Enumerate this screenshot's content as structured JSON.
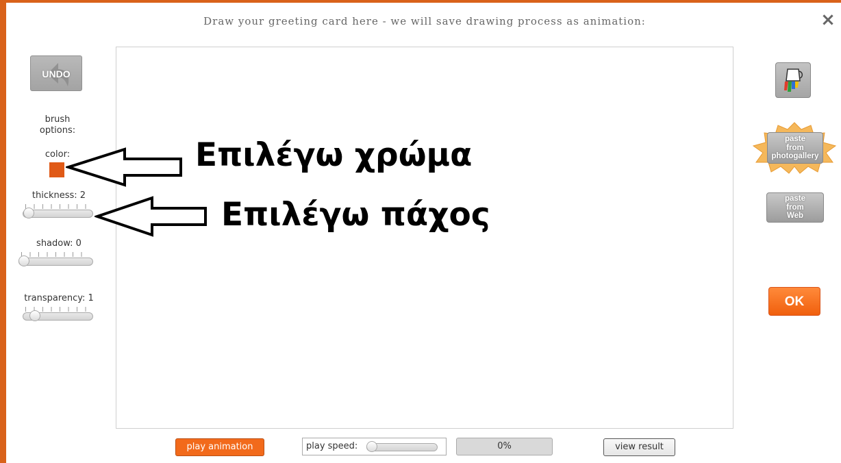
{
  "header": {
    "title": "Draw your greeting card here - we will save drawing process as animation:",
    "close_icon": "×"
  },
  "left_panel": {
    "undo_label": "UNDO",
    "brush_options_line1": "brush",
    "brush_options_line2": "options:",
    "color_label": "color:",
    "color_value": "#e05a17",
    "thickness_label": "thickness: 2",
    "shadow_label": "shadow: 0",
    "transparency_label": "transparency: 1"
  },
  "annotations": {
    "color_note": "Επιλέγω χρώμα",
    "thickness_note": "Επιλέγω πάχος"
  },
  "right_panel": {
    "paste_photogallery": [
      "paste",
      "from",
      "photogallery"
    ],
    "paste_web": [
      "paste",
      "from",
      "Web"
    ],
    "ok_label": "OK",
    "paint_icon": "paint-bucket-icon"
  },
  "bottom_bar": {
    "play_label": "play animation",
    "speed_label": "play speed:",
    "progress_label": "0%",
    "view_label": "view result"
  },
  "colors": {
    "accent": "#f26a1b",
    "frame": "#d9621a"
  }
}
